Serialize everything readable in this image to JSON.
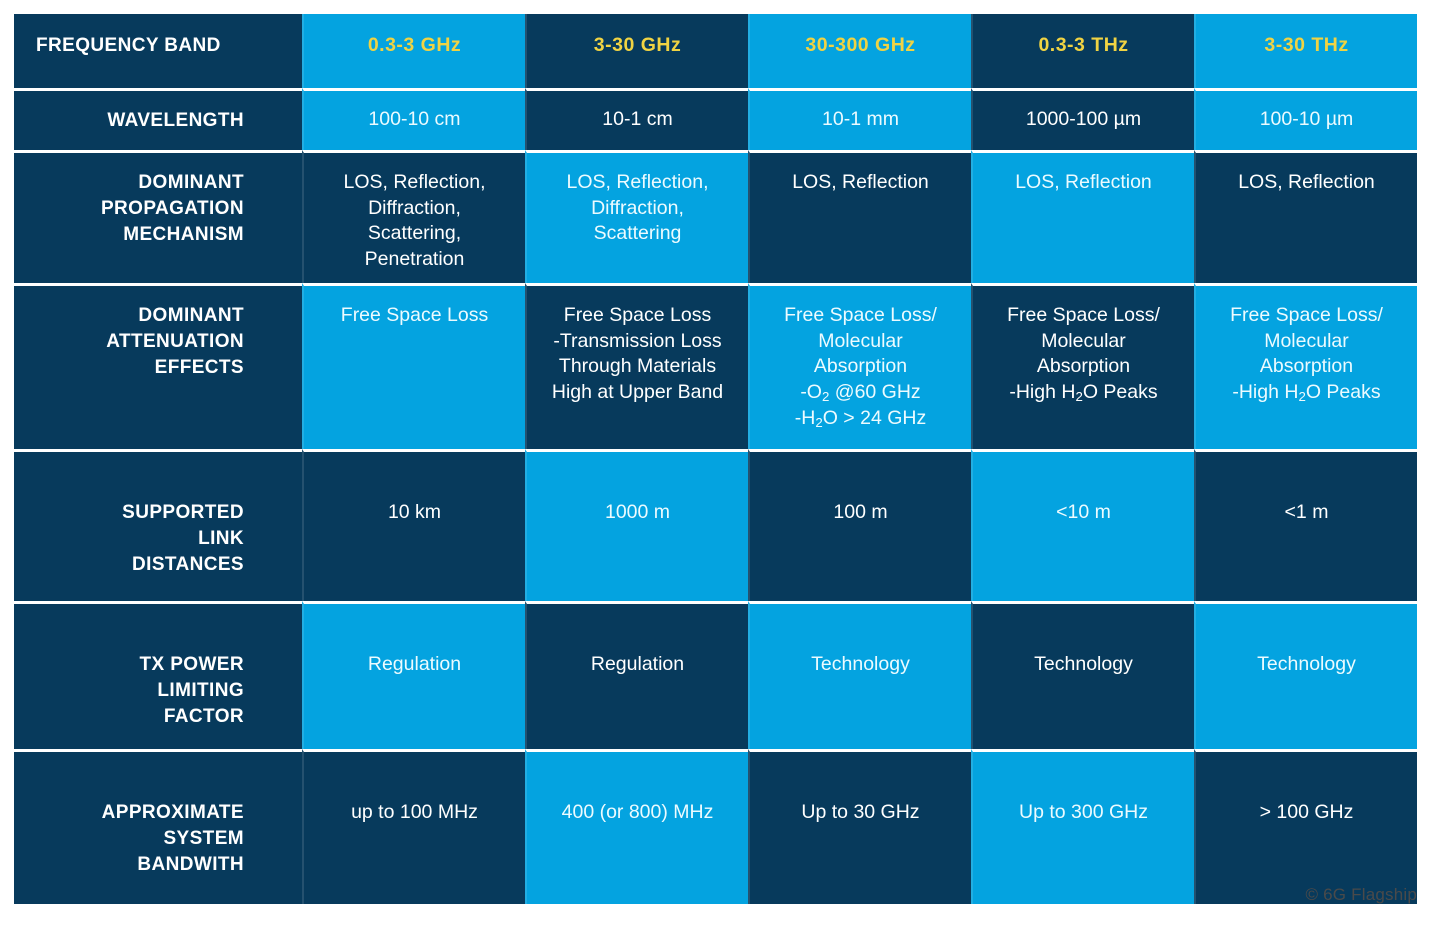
{
  "table": {
    "row_label_header": "FREQUENCY BAND",
    "columns": [
      {
        "band": "0.3-3 GHz",
        "shade": "light"
      },
      {
        "band": "3-30 GHz",
        "shade": "dark"
      },
      {
        "band": "30-300 GHz",
        "shade": "light"
      },
      {
        "band": "0.3-3 THz",
        "shade": "dark"
      },
      {
        "band": "3-30 THz",
        "shade": "light"
      }
    ],
    "rows": [
      {
        "key": "wavelength",
        "label": "WAVELENGTH",
        "cells": [
          {
            "lines": [
              "100-10 cm"
            ]
          },
          {
            "lines": [
              "10-1 cm"
            ]
          },
          {
            "lines": [
              "10-1 mm"
            ]
          },
          {
            "lines": [
              "1000-100 µm"
            ]
          },
          {
            "lines": [
              "100-10 µm"
            ]
          }
        ]
      },
      {
        "key": "propagation",
        "label": "DOMINANT\nPROPAGATION\nMECHANISM",
        "cells": [
          {
            "lines": [
              "LOS, Reflection,",
              "Diffraction,",
              "Scattering,",
              "Penetration"
            ]
          },
          {
            "lines": [
              "LOS, Reflection,",
              "Diffraction,",
              "Scattering"
            ]
          },
          {
            "lines": [
              "LOS, Reflection"
            ]
          },
          {
            "lines": [
              "LOS, Reflection"
            ]
          },
          {
            "lines": [
              "LOS, Reflection"
            ]
          }
        ]
      },
      {
        "key": "attenuation",
        "label": "DOMINANT\nATTENUATION\nEFFECTS",
        "cells": [
          {
            "lines": [
              "Free Space Loss"
            ]
          },
          {
            "lines": [
              "Free Space Loss",
              "-Transmission Loss",
              "Through Materials",
              "High at Upper Band"
            ]
          },
          {
            "lines": [
              "Free Space Loss/",
              "Molecular",
              "Absorption",
              "-O<sub>2</sub> @60 GHz",
              "-H<sub>2</sub>O > 24 GHz"
            ],
            "html": true
          },
          {
            "lines": [
              "Free Space Loss/",
              "Molecular",
              "Absorption",
              "-High H<sub>2</sub>O Peaks"
            ],
            "html": true
          },
          {
            "lines": [
              "Free Space Loss/",
              "Molecular",
              "Absorption",
              "-High H<sub>2</sub>O Peaks"
            ],
            "html": true
          }
        ]
      },
      {
        "key": "distance",
        "label": "SUPPORTED\nLINK\nDISTANCES",
        "cells": [
          {
            "lines": [
              "10 km"
            ]
          },
          {
            "lines": [
              "1000 m"
            ]
          },
          {
            "lines": [
              "100 m"
            ]
          },
          {
            "lines": [
              "<10 m"
            ]
          },
          {
            "lines": [
              "<1 m"
            ]
          }
        ]
      },
      {
        "key": "txpower",
        "label": "TX POWER\nLIMITING\nFACTOR",
        "cells": [
          {
            "lines": [
              "Regulation"
            ]
          },
          {
            "lines": [
              "Regulation"
            ]
          },
          {
            "lines": [
              "Technology"
            ]
          },
          {
            "lines": [
              "Technology"
            ]
          },
          {
            "lines": [
              "Technology"
            ]
          }
        ]
      },
      {
        "key": "bandwidth",
        "label": "APPROXIMATE\nSYSTEM\nBANDWITH",
        "cells": [
          {
            "lines": [
              "up to 100 MHz"
            ]
          },
          {
            "lines": [
              "400 (or 800) MHz"
            ]
          },
          {
            "lines": [
              "Up to 30 GHz"
            ]
          },
          {
            "lines": [
              "Up to 300 GHz"
            ]
          },
          {
            "lines": [
              "> 100 GHz"
            ]
          }
        ]
      }
    ]
  },
  "credit": "© 6G Flagship",
  "colors": {
    "dark_cell": "#073a5c",
    "light_cell": "#04a3e0",
    "header_band_text": "#f0d343",
    "cell_text": "#ffffff",
    "separator": "#ffffff",
    "page_background": "#ffffff"
  }
}
